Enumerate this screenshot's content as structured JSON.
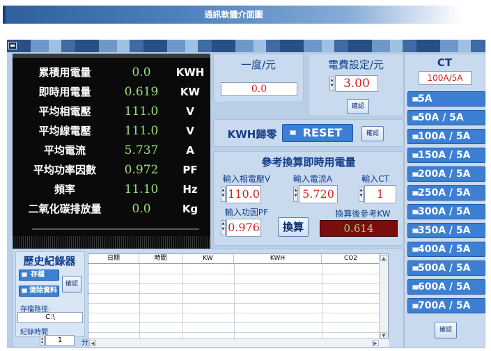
{
  "banner": {
    "title": "通訊軟體介面圖"
  },
  "meters": [
    {
      "label": "累積用電量",
      "value": "0.0",
      "unit": "KWH"
    },
    {
      "label": "即時用電量",
      "value": "0.619",
      "unit": "KW"
    },
    {
      "label": "平均相電壓",
      "value": "111.0",
      "unit": "V"
    },
    {
      "label": "平均線電壓",
      "value": "111.0",
      "unit": "V"
    },
    {
      "label": "平均電流",
      "value": "5.737",
      "unit": "A"
    },
    {
      "label": "平均功率因數",
      "value": "0.972",
      "unit": "PF"
    },
    {
      "label": "頻率",
      "value": "11.10",
      "unit": "Hz"
    },
    {
      "label": "二氧化碳排放量",
      "value": "0.0",
      "unit": "Kg"
    }
  ],
  "price": {
    "per_degree_title": "一度/元",
    "per_degree_value": "0.0",
    "setting_title": "電費設定/元",
    "setting_value": "3.00",
    "confirm": "確認"
  },
  "kwh_reset": {
    "label": "KWH歸零",
    "reset_label": "RESET",
    "confirm": "確認"
  },
  "reference": {
    "title": "參考換算即時用電量",
    "phase_voltage_label": "輸入相電壓V",
    "phase_voltage_value": "110.0",
    "current_label": "輸入電流A",
    "current_value": "5.720",
    "ct_label": "輸入CT",
    "ct_value": "1",
    "pf_label": "輸入功因PF",
    "pf_value": "0.976",
    "convert_label": "換算",
    "result_label": "換算後參考KW",
    "result_value": "0.614"
  },
  "ct": {
    "title": "CT",
    "current": "100A/5A",
    "options": [
      "5A",
      "50A / 5A",
      "100A / 5A",
      "150A / 5A",
      "200A / 5A",
      "250A / 5A",
      "300A / 5A",
      "350A / 5A",
      "400A / 5A",
      "500A / 5A",
      "600A / 5A",
      "700A / 5A"
    ],
    "confirm": "確認"
  },
  "history": {
    "title": "歷史紀錄器",
    "save_label": "存檔",
    "clear_label": "清除資料",
    "confirm": "確認",
    "path_label": "存檔路徑:",
    "path_value": "C:\\",
    "interval_label": "紀錄時間",
    "interval_value": "1",
    "interval_unit": "分",
    "columns": [
      "日期",
      "時間",
      "KW",
      "KWH",
      "CO2"
    ]
  },
  "colors": {
    "meter_value": "#9be07a",
    "accent_blue": "#3c7fd3",
    "title_blue": "#123e8a",
    "red_text": "#d0201e"
  }
}
